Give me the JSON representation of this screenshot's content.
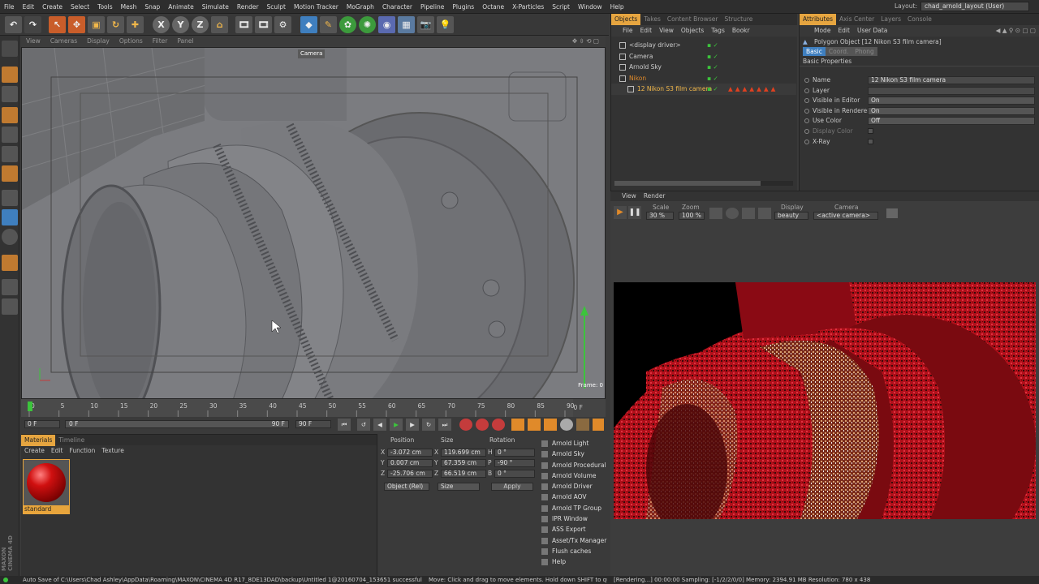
{
  "menubar": {
    "items": [
      "File",
      "Edit",
      "Create",
      "Select",
      "Tools",
      "Mesh",
      "Snap",
      "Animate",
      "Simulate",
      "Render",
      "Sculpt",
      "Motion Tracker",
      "MoGraph",
      "Character",
      "Pipeline",
      "Plugins",
      "Octane",
      "X-Particles",
      "Script",
      "Window",
      "Help"
    ],
    "layout_label": "Layout:",
    "layout_value": "chad_arnold_layout (User)"
  },
  "toolbar": {
    "axis_x": "X",
    "axis_y": "Y",
    "axis_z": "Z"
  },
  "viewport": {
    "menu": [
      "View",
      "Cameras",
      "Display",
      "Options",
      "Filter",
      "Panel"
    ],
    "camera_label": "Camera",
    "frame_label": "Frame: 0"
  },
  "timeline": {
    "ticks": [
      "0",
      "5",
      "10",
      "15",
      "20",
      "25",
      "30",
      "35",
      "40",
      "45",
      "50",
      "55",
      "60",
      "65",
      "70",
      "75",
      "80",
      "85",
      "90"
    ],
    "end_label": "0 F"
  },
  "playback": {
    "start_frame": "0 F",
    "range_start": "0 F",
    "range_end": "90 F",
    "end_frame": "90 F"
  },
  "material": {
    "tabs": [
      "Materials",
      "Timeline"
    ],
    "menu": [
      "Create",
      "Edit",
      "Function",
      "Texture"
    ],
    "item_name": "standard"
  },
  "coords": {
    "headers": [
      "Position",
      "Size",
      "Rotation"
    ],
    "rows": [
      {
        "axis": "X",
        "pos": "-3.072 cm",
        "size_axis": "X",
        "size": "119.699 cm",
        "rot_axis": "H",
        "rot": "0 °"
      },
      {
        "axis": "Y",
        "pos": "0.007 cm",
        "size_axis": "Y",
        "size": "67.359 cm",
        "rot_axis": "P",
        "rot": "-90 °"
      },
      {
        "axis": "Z",
        "pos": "-25.706 cm",
        "size_axis": "Z",
        "size": "66.519 cm",
        "rot_axis": "B",
        "rot": "0 °"
      }
    ],
    "mode_select": "Object (Rel)",
    "size_select": "Size",
    "apply_label": "Apply"
  },
  "arnold_menu": [
    "Arnold Light",
    "Arnold Sky",
    "Arnold Procedural",
    "Arnold Volume",
    "Arnold Driver",
    "Arnold AOV",
    "Arnold TP Group",
    "IPR Window",
    "ASS Export",
    "Asset/Tx Manager",
    "Flush caches",
    "Help"
  ],
  "objects": {
    "tabs": [
      "Objects",
      "Takes",
      "Content Browser",
      "Structure"
    ],
    "menu": [
      "File",
      "Edit",
      "View",
      "Objects",
      "Tags",
      "Bookr"
    ],
    "items": [
      {
        "name": "<display driver>",
        "color": "#cccccc"
      },
      {
        "name": "Camera",
        "color": "#cccccc"
      },
      {
        "name": "Arnold Sky",
        "color": "#cccccc"
      },
      {
        "name": "Nikon",
        "color": "#e08a2a"
      },
      {
        "name": "12 Nikon S3 film camera",
        "color": "#f2b84a"
      }
    ]
  },
  "attributes": {
    "tabs": [
      "Attributes",
      "Axis Center",
      "Layers",
      "Console"
    ],
    "menu": [
      "Mode",
      "Edit",
      "User Data"
    ],
    "object_title": "Polygon Object [12 Nikon S3 film camera]",
    "subtabs": [
      "Basic",
      "Coord.",
      "Phong"
    ],
    "section": "Basic Properties",
    "props": [
      {
        "label": "Name",
        "value": "12 Nikon S3 film camera"
      },
      {
        "label": "Layer",
        "value": ""
      },
      {
        "label": "Visible in Editor",
        "value": "On"
      },
      {
        "label": "Visible in Renderer",
        "value": "On"
      },
      {
        "label": "Use Color",
        "value": "Off"
      },
      {
        "label": "Display Color",
        "value": ""
      },
      {
        "label": "X-Ray",
        "value": ""
      }
    ]
  },
  "ipr": {
    "menu": [
      "View",
      "Render"
    ],
    "scale_label": "Scale",
    "scale_value": "30 %",
    "zoom_label": "Zoom",
    "zoom_value": "100 %",
    "display_label": "Display",
    "display_value": "beauty",
    "camera_label": "Camera",
    "camera_value": "<active camera>"
  },
  "status": {
    "left": "Auto Save of C:\\Users\\Chad Ashley\\AppData\\Roaming\\MAXON\\CINEMA 4D R17_8DE13DAD\\backup\\Untitled 1@20160704_153651 successful",
    "middle": "Move: Click and drag to move elements. Hold down SHIFT to qu",
    "right": "[Rendering...]  00:00:00  Sampling: [-1/2/2/0/0]  Memory: 2394.91 MB  Resolution: 780 x 438"
  },
  "brand": "MAXON CINEMA 4D"
}
